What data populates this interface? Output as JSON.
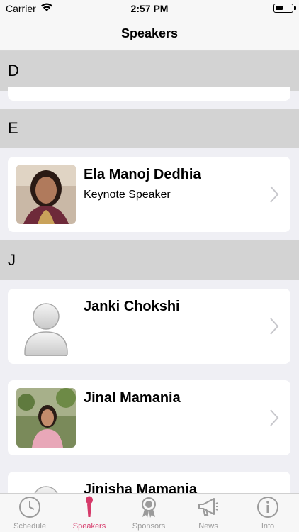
{
  "status_bar": {
    "carrier": "Carrier",
    "time": "2:57 PM"
  },
  "nav": {
    "title": "Speakers"
  },
  "sections": [
    {
      "letter": "D"
    },
    {
      "letter": "E"
    },
    {
      "letter": "J"
    }
  ],
  "speakers": [
    {
      "name": "Ela Manoj Dedhia",
      "role": "Keynote Speaker"
    },
    {
      "name": "Janki Chokshi",
      "role": ""
    },
    {
      "name": "Jinal Mamania",
      "role": ""
    },
    {
      "name": "Jinisha Mamania",
      "role": ""
    }
  ],
  "tabs": [
    {
      "label": "Schedule",
      "icon": "clock-icon"
    },
    {
      "label": "Speakers",
      "icon": "microphone-icon"
    },
    {
      "label": "Sponsors",
      "icon": "badge-icon"
    },
    {
      "label": "News",
      "icon": "megaphone-icon"
    },
    {
      "label": "Info",
      "icon": "info-icon"
    }
  ],
  "colors": {
    "accent": "#d63a6a",
    "inactive": "#9b9b9b",
    "section_bg": "#d3d3d3"
  }
}
